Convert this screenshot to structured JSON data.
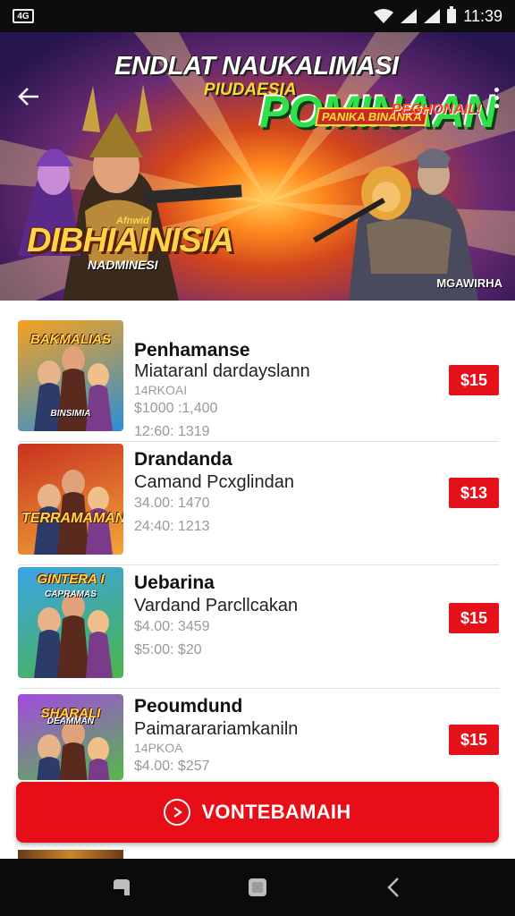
{
  "status_bar": {
    "sim_label": "4G",
    "time": "11:39"
  },
  "hero": {
    "title_line1": "ENDLAT NAUKALIMASI",
    "title_line2": "PIUDAESIA",
    "title_big": "POMINAAN",
    "tag1": "PANIKA BINANKA",
    "tag2": "PEGHONAIL!",
    "logo_main": "DIBHIAINISIA",
    "logo_sub": "NADMINESI",
    "logo_small": "Afnwid",
    "corner_label": "MGAWIRHA",
    "carousel_count": 4,
    "carousel_active": 1
  },
  "games": [
    {
      "thumb_title": "BAKMALIAS",
      "thumb_sub": "BINSIMIA",
      "title": "Penhamanse",
      "subtitle": "Miataranl dardayslann",
      "meta1": "14RKOAI",
      "meta2": "$1000 :1,400",
      "meta3": "12:60: 1319",
      "price": "$15",
      "thumb_colors": [
        "#f6a21f",
        "#2a8fd6"
      ]
    },
    {
      "thumb_title": "TERRAMAMAN",
      "thumb_sub": "",
      "title": "Drandanda",
      "subtitle": "Camand Pcxglindan",
      "meta1": "",
      "meta2": "34.00: 1470",
      "meta3": "24:40: 1213",
      "price": "$13",
      "thumb_colors": [
        "#c8321f",
        "#f2a53a"
      ]
    },
    {
      "thumb_title": "GINTERA I",
      "thumb_sub": "CAPRAMAS",
      "title": "Uebarina",
      "subtitle": "Vardand Parcllcakan",
      "meta1": "",
      "meta2": "$4.00: 3459",
      "meta3": "$5:00: $20",
      "price": "$15",
      "thumb_colors": [
        "#3aa3e6",
        "#4cb54a"
      ]
    },
    {
      "thumb_title": "SHARALI",
      "thumb_sub": "DEAMMAN",
      "title": "Peoumdund",
      "subtitle": "Paimararariamkaniln",
      "meta1": "14PKOA",
      "meta2": "$4.00: $257",
      "meta3": "",
      "price": "$15",
      "thumb_colors": [
        "#a24ae0",
        "#57b84a"
      ]
    }
  ],
  "cta": {
    "label": "VONTEBAMAIH"
  },
  "colors": {
    "accent": "#e80e17",
    "price_bg": "#e4101a"
  }
}
